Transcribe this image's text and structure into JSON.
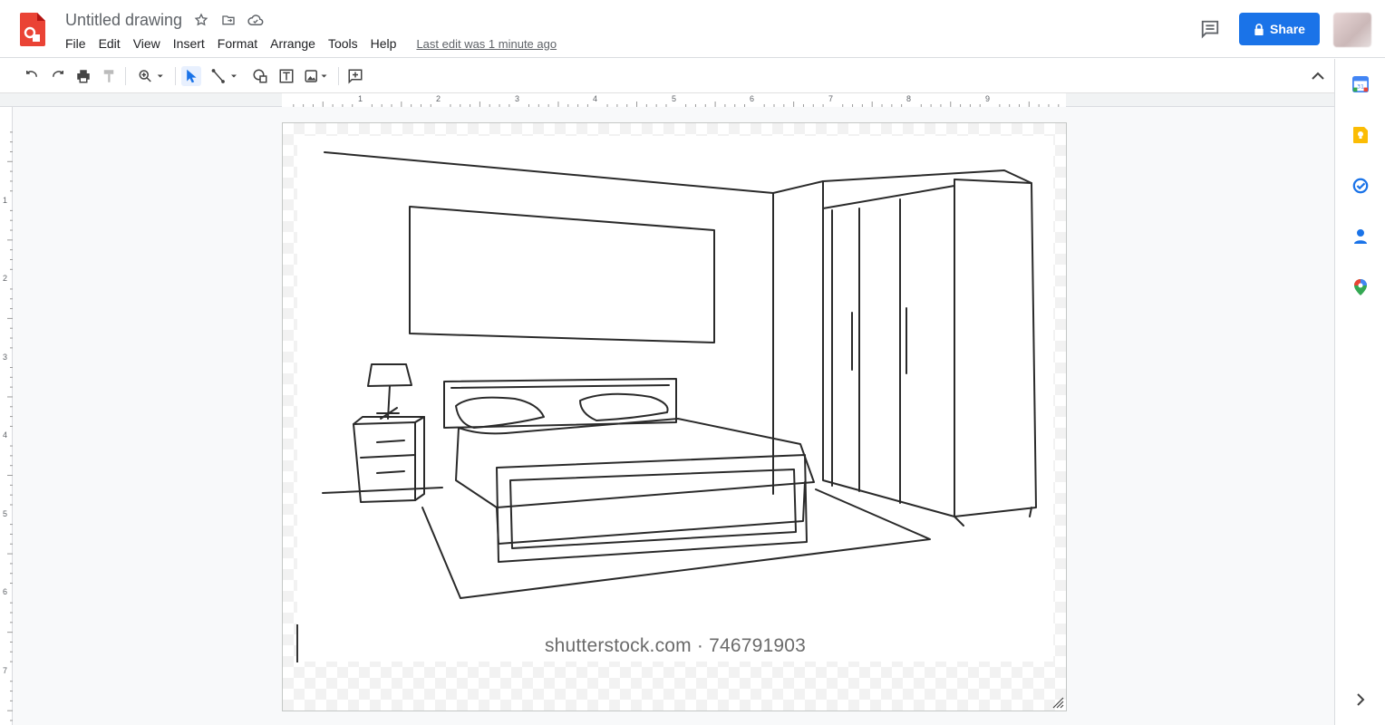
{
  "header": {
    "title": "Untitled drawing",
    "menus": [
      "File",
      "Edit",
      "View",
      "Insert",
      "Format",
      "Arrange",
      "Tools",
      "Help"
    ],
    "last_edit": "Last edit was 1 minute ago",
    "share_label": "Share"
  },
  "toolbar": {
    "tools": [
      "undo-icon",
      "redo-icon",
      "print-icon",
      "paint-format-icon",
      "zoom-icon",
      "select-icon",
      "line-icon",
      "shape-icon",
      "text-box-icon",
      "image-icon",
      "add-comment-icon"
    ],
    "active_tool": "select-icon"
  },
  "ruler": {
    "horizontal": [
      "1",
      "2",
      "3",
      "4",
      "5",
      "6",
      "7",
      "8",
      "9"
    ],
    "vertical": [
      "1",
      "2",
      "3",
      "4",
      "5",
      "6",
      "7"
    ]
  },
  "canvas": {
    "watermark": "shutterstock.com · 746791903"
  },
  "side_panel": {
    "apps": [
      "calendar-icon",
      "keep-icon",
      "tasks-icon",
      "contacts-icon",
      "maps-icon"
    ]
  },
  "colors": {
    "accent": "#1a73e8",
    "logo": "#ea4335"
  }
}
